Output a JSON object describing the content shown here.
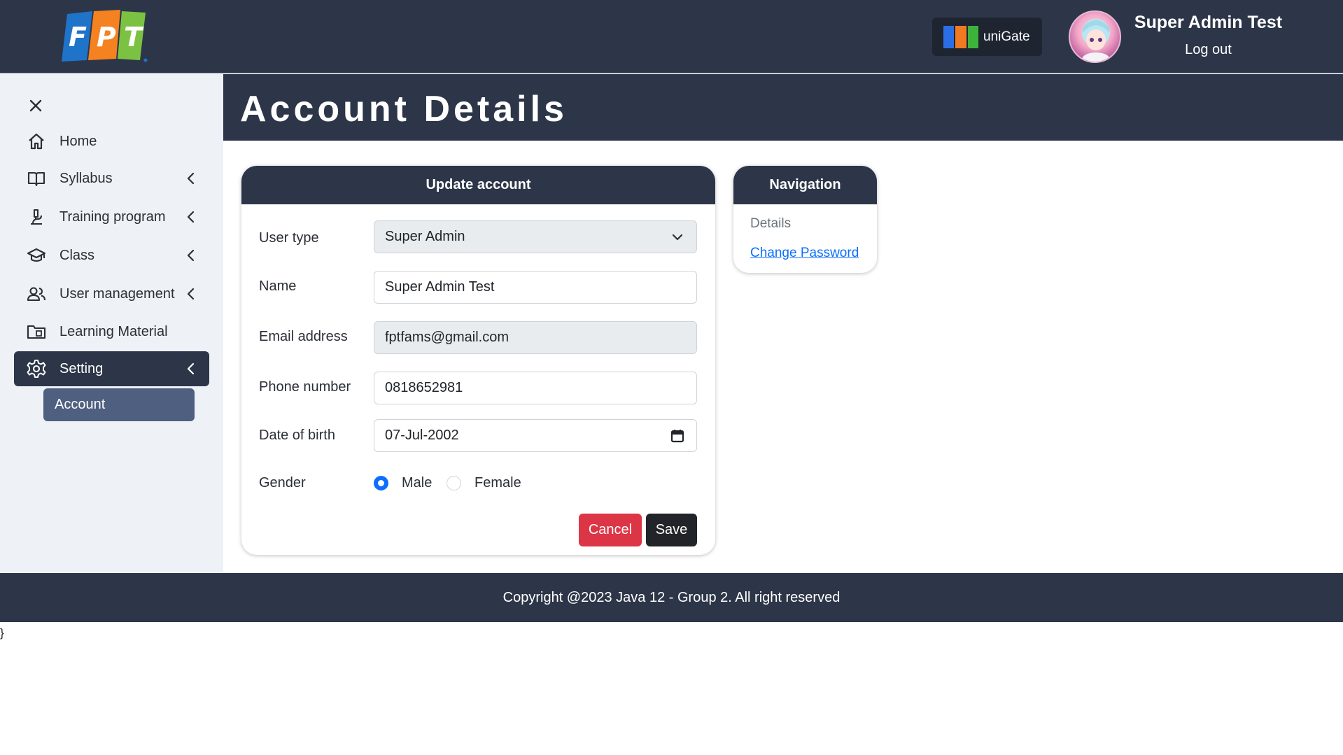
{
  "header": {
    "logo_text": "FPT",
    "unigate_label": "uniGate",
    "user_name": "Super Admin Test",
    "logout_label": "Log out",
    "colors": {
      "bar": "#2d3648",
      "fpt_blue": "#1f73c9",
      "fpt_orange": "#f58220",
      "fpt_green": "#7cc242"
    }
  },
  "sidebar": {
    "close_icon": "close-icon",
    "items": [
      {
        "label": "Home",
        "icon": "home-icon",
        "has_chevron": false
      },
      {
        "label": "Syllabus",
        "icon": "book-icon",
        "has_chevron": true
      },
      {
        "label": "Training program",
        "icon": "microscope-icon",
        "has_chevron": true
      },
      {
        "label": "Class",
        "icon": "graduation-cap-icon",
        "has_chevron": true
      },
      {
        "label": "User management",
        "icon": "users-icon",
        "has_chevron": true
      },
      {
        "label": "Learning Material",
        "icon": "folder-icon",
        "has_chevron": false
      },
      {
        "label": "Setting",
        "icon": "gear-icon",
        "has_chevron": true,
        "active": true
      }
    ],
    "sub_item": {
      "label": "Account",
      "active": true
    }
  },
  "page": {
    "title": "Account Details"
  },
  "update_card": {
    "title": "Update account",
    "user_type": {
      "label": "User type",
      "value": "Super Admin"
    },
    "name": {
      "label": "Name",
      "value": "Super Admin Test"
    },
    "email": {
      "label": "Email address",
      "value": "fptfams@gmail.com"
    },
    "phone": {
      "label": "Phone number",
      "value": "0818652981"
    },
    "dob": {
      "label": "Date of birth",
      "value": "07-Jul-2002"
    },
    "gender": {
      "label": "Gender",
      "options": [
        "Male",
        "Female"
      ],
      "selected": "Male"
    },
    "cancel_label": "Cancel",
    "save_label": "Save"
  },
  "nav_card": {
    "title": "Navigation",
    "details_label": "Details",
    "change_password_label": "Change Password"
  },
  "footer": {
    "text": "Copyright @2023 Java 12 - Group 2. All right reserved"
  },
  "stray_text": "}"
}
